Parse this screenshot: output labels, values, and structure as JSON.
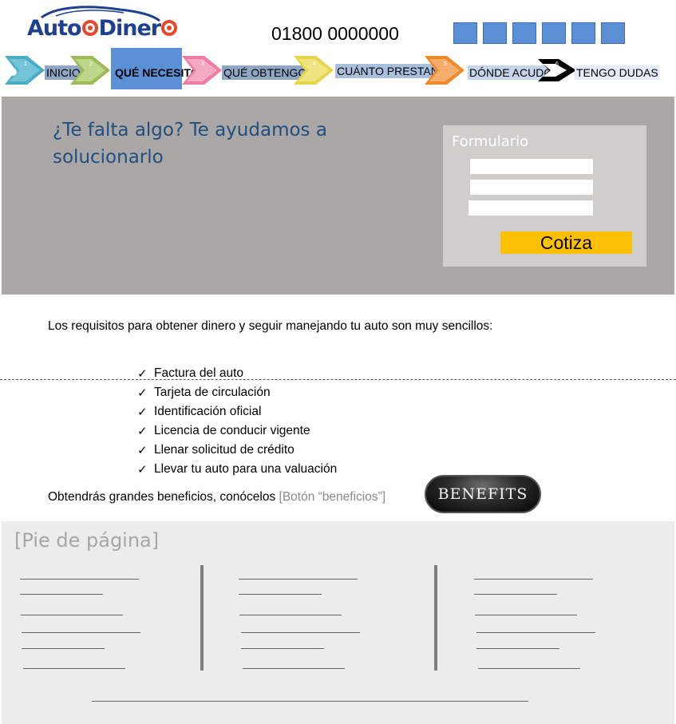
{
  "header": {
    "logo_text_a": "Auto",
    "logo_text_b": "Diner",
    "phone": "01800 0000000",
    "social_icons": [
      "social-icon-1",
      "social-icon-2",
      "social-icon-3",
      "social-icon-4",
      "social-icon-5",
      "social-icon-6"
    ]
  },
  "nav": {
    "items": [
      {
        "num": "1",
        "label": "INICIO",
        "color": "#4bacc6"
      },
      {
        "num": "2",
        "label": "QUÉ NECESITO",
        "color": "#9bbb59"
      },
      {
        "num": "3",
        "label": "QUÉ OBTENGO",
        "color": "#f07ba0"
      },
      {
        "num": "4",
        "label": "CUÁNTO PRESTAN",
        "color": "#e5d64a"
      },
      {
        "num": "5",
        "label": "DÓNDE ACUDO",
        "color": "#f0892a"
      },
      {
        "num": "6",
        "label": "TENGO DUDAS",
        "color": "#000000"
      }
    ],
    "active_index": 1
  },
  "hero": {
    "title": "¿Te falta algo? Te ayudamos a solucionarlo",
    "form": {
      "title": "Formulario",
      "fields": [
        "",
        "",
        ""
      ],
      "submit_label": "Cotiza"
    }
  },
  "content": {
    "intro": "Los requisitos para obtener dinero y seguir manejando tu auto son muy sencillos:",
    "requirements": [
      "Factura del auto",
      "Tarjeta de circulación",
      "Identificación oficial",
      "Licencia de conducir vigente",
      "Llenar solicitud de crédito",
      "Llevar tu auto para una valuación"
    ],
    "benefits_text": "Obtendrás grandes beneficios, conócelos",
    "benefits_note": "[Botón “beneficios”]",
    "benefits_button": "BENEFITS"
  },
  "footer": {
    "title": "[Pie de página]"
  },
  "colors": {
    "accent_blue": "#5b8fd6",
    "hero_bg": "#aba7a6",
    "cta_yellow": "#ffc000",
    "title_blue": "#1f4f80"
  }
}
